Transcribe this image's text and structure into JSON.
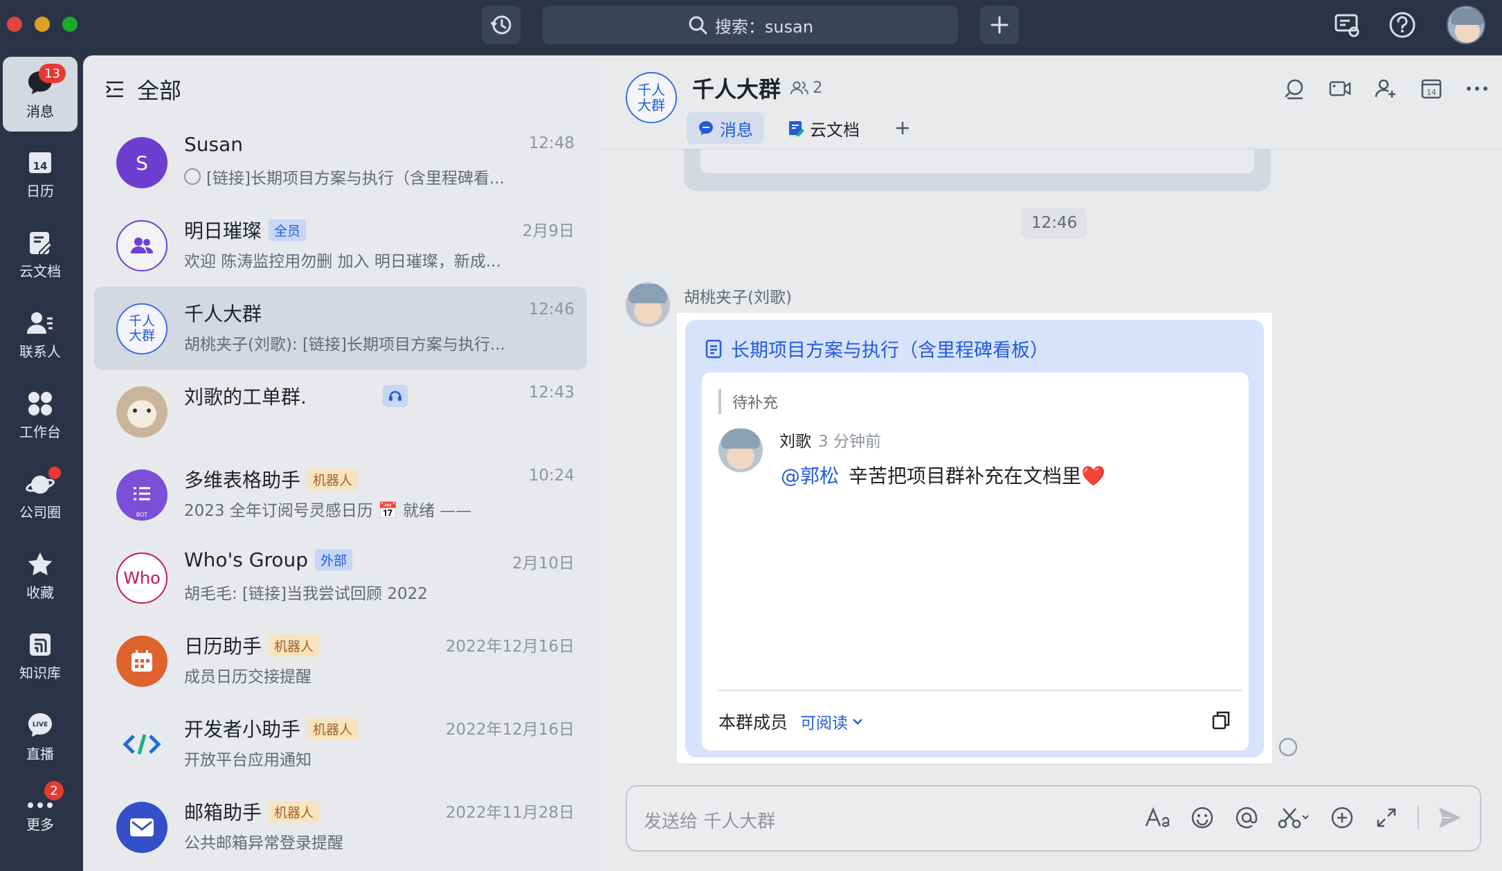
{
  "titlebar": {
    "search_label": "搜索：susan",
    "history_icon": "history-icon",
    "add_icon": "plus-icon"
  },
  "rail": {
    "items": [
      {
        "label": "消息",
        "badge": "13",
        "icon": "message-icon"
      },
      {
        "label": "日历",
        "icon": "calendar-icon",
        "icon_text": "14"
      },
      {
        "label": "云文档",
        "icon": "cloud-doc-icon"
      },
      {
        "label": "联系人",
        "icon": "contacts-icon"
      },
      {
        "label": "工作台",
        "icon": "workplace-icon"
      },
      {
        "label": "公司圈",
        "icon": "moments-icon"
      },
      {
        "label": "收藏",
        "icon": "star-icon"
      },
      {
        "label": "知识库",
        "icon": "wiki-icon"
      },
      {
        "label": "直播",
        "icon": "live-icon",
        "icon_text": "LIVE"
      },
      {
        "label": "更多",
        "badge": "2",
        "icon": "more-icon"
      }
    ]
  },
  "list": {
    "title": "全部",
    "rows": [
      {
        "name": "Susan",
        "subtitle": "[链接]长期项目方案与执行（含里程碑看...",
        "time": "12:48",
        "avatar_text": "S"
      },
      {
        "name": "明日璀璨",
        "tag": "全员",
        "subtitle": "欢迎 陈涛监控用勿删 加入 明日璀璨，新成...",
        "time": "2月9日"
      },
      {
        "name": "千人大群",
        "subtitle": "胡桃夹子(刘歌): [链接]长期项目方案与执行...",
        "time": "12:46",
        "avatar_text": "千人大群"
      },
      {
        "name": "刘歌的工单群.",
        "subtitle": "",
        "time": "12:43"
      },
      {
        "name": "多维表格助手",
        "tag": "机器人",
        "subtitle": "2023 全年订阅号灵感日历 📅 就绪 ——",
        "time": "10:24",
        "avatar_text": "BOT"
      },
      {
        "name": "Who's Group",
        "tag": "外部",
        "subtitle": "胡毛毛: [链接]当我尝试回顾 2022",
        "time": "2月10日",
        "avatar_text": "Who"
      },
      {
        "name": "日历助手",
        "tag": "机器人",
        "subtitle": "成员日历交接提醒",
        "time": "2022年12月16日"
      },
      {
        "name": "开发者小助手",
        "tag": "机器人",
        "subtitle": "开放平台应用通知",
        "time": "2022年12月16日"
      },
      {
        "name": "邮箱助手",
        "tag": "机器人",
        "subtitle": "公共邮箱异常登录提醒",
        "time": "2022年11月28日"
      }
    ]
  },
  "chat": {
    "avatar_text": "千人大群",
    "title": "千人大群",
    "member_count": "2",
    "tabs": [
      {
        "label": "消息"
      },
      {
        "label": "云文档"
      }
    ],
    "time_separator": "12:46",
    "sender": "胡桃夹子(刘歌)",
    "card": {
      "title": "长期项目方案与执行（含里程碑看板）",
      "quote": "待补充",
      "comment_author": "刘歌",
      "comment_time": "3 分钟前",
      "mention": "@郭松",
      "comment_text": "辛苦把项目群补充在文档里❤️",
      "permission_scope": "本群成员",
      "permission_level": "可阅读"
    },
    "composer_placeholder": "发送给 千人大群"
  },
  "colors": {
    "rail_bg": "#2b3446",
    "accent": "#245bdb",
    "badge": "#e53935",
    "list_bg": "#e8e9ec",
    "chat_bg": "#e9eaec"
  }
}
